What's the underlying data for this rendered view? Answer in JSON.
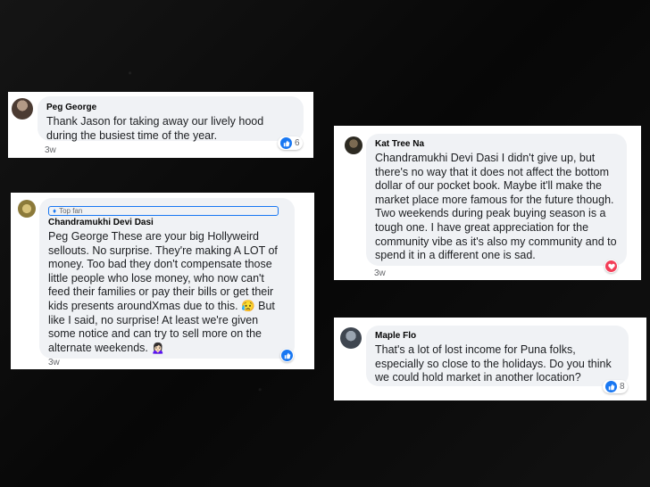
{
  "comments": [
    {
      "author": "Peg George",
      "text": "Thank Jason for taking away our lively hood during the busiest time of the year.",
      "time": "3w",
      "reaction": {
        "icon": "like-icon",
        "count": "6"
      }
    },
    {
      "author": "Kat Tree Na",
      "text": "Chandramukhi Devi Dasi I didn't give up, but there's no way that it does not affect the bottom dollar of our pocket book. Maybe it'll make the market place more famous for the future though. Two weekends during peak buying season is a tough one. I have great appreciation for the community vibe as it's also my community and to spend it in a different one is sad.",
      "time": "3w",
      "reaction": {
        "icon": "love-icon",
        "count": ""
      }
    },
    {
      "badge": "Top fan",
      "author": "Chandramukhi Devi Dasi",
      "text": "Peg George These are your big Hollyweird sellouts. No surprise. They're making A LOT of money. Too bad they don't compensate those little people who lose money, who now can't feed their families or pay their bills or get their kids presents aroundXmas due to this. 😥 But like I said, no surprise! At least we're given some notice and can try to sell more on the alternate weekends. 🙍🏻‍♀️",
      "time": "3w",
      "reaction": {
        "icon": "like-icon",
        "count": ""
      }
    },
    {
      "author": "Maple Flo",
      "text": "That's a lot of lost income for Puna folks, especially so close to the holidays. Do you think we could hold market in another location?",
      "time": "3w",
      "reaction": {
        "icon": "like-icon",
        "count": "8"
      }
    }
  ],
  "colors": {
    "like": "#1877f2",
    "love": "#f33e58",
    "bubble": "#f0f2f5"
  }
}
